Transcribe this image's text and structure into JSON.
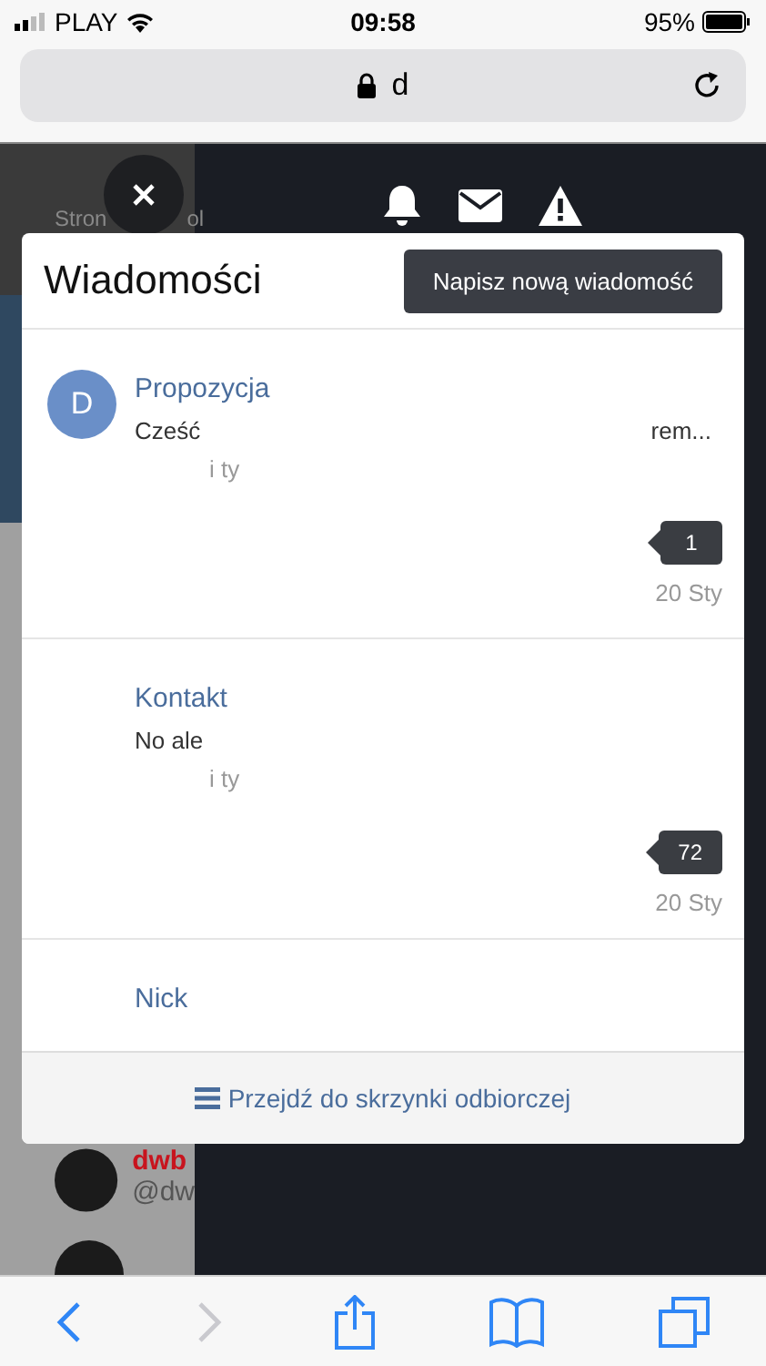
{
  "status_bar": {
    "carrier": "PLAY",
    "time": "09:58",
    "battery": "95%"
  },
  "address_bar": {
    "url": "d"
  },
  "background_page": {
    "sidebar_texts": [
      "Stron",
      "ol"
    ],
    "user_name": "dwb",
    "user_handle": "@dw"
  },
  "messages_panel": {
    "title": "Wiadomości",
    "compose_button": "Napisz nową wiadomość",
    "messages": [
      {
        "subject": "Propozycja",
        "avatar": "D",
        "preview": "Cześć",
        "preview_end": "rem...",
        "note": "i ty",
        "count": "1",
        "date": "20 Sty"
      },
      {
        "subject": "Kontakt",
        "preview": "No ale",
        "note": "i ty",
        "count": "72",
        "date": "20 Sty"
      },
      {
        "subject": "Nick"
      }
    ],
    "footer_link": "Przejdź do skrzynki odbiorczej"
  },
  "browser_toolbar": [
    {
      "kind": "back",
      "disabled": false
    },
    {
      "kind": "forward",
      "disabled": true
    },
    {
      "kind": "share",
      "disabled": false
    },
    {
      "kind": "bookmarks",
      "disabled": false
    },
    {
      "kind": "tabs",
      "disabled": false
    }
  ]
}
